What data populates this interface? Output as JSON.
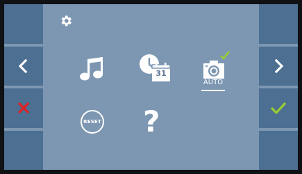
{
  "colors": {
    "frame": "#0f1115",
    "panel": "#7d97b2",
    "side_button": "#4d6f92",
    "accept": "#9acd32",
    "cancel": "#e02020",
    "icon": "#ffffff"
  },
  "left_buttons": [
    {
      "icon": "empty"
    },
    {
      "icon": "chevron-left-icon"
    },
    {
      "icon": "close-icon"
    },
    {
      "icon": "empty"
    }
  ],
  "right_buttons": [
    {
      "icon": "empty"
    },
    {
      "icon": "chevron-right-icon"
    },
    {
      "icon": "check-icon"
    },
    {
      "icon": "empty"
    }
  ],
  "settings": {
    "icon": "gear-icon"
  },
  "menu": {
    "ringtone": {
      "icon": "music-note-icon"
    },
    "date_time": {
      "icon": "clock-calendar-icon",
      "calendar_day": "31"
    },
    "auto_capture": {
      "icon": "camera-icon",
      "label": "AUTO",
      "checked": true
    },
    "reset": {
      "label": "RESET"
    },
    "help": {
      "glyph": "?"
    }
  }
}
